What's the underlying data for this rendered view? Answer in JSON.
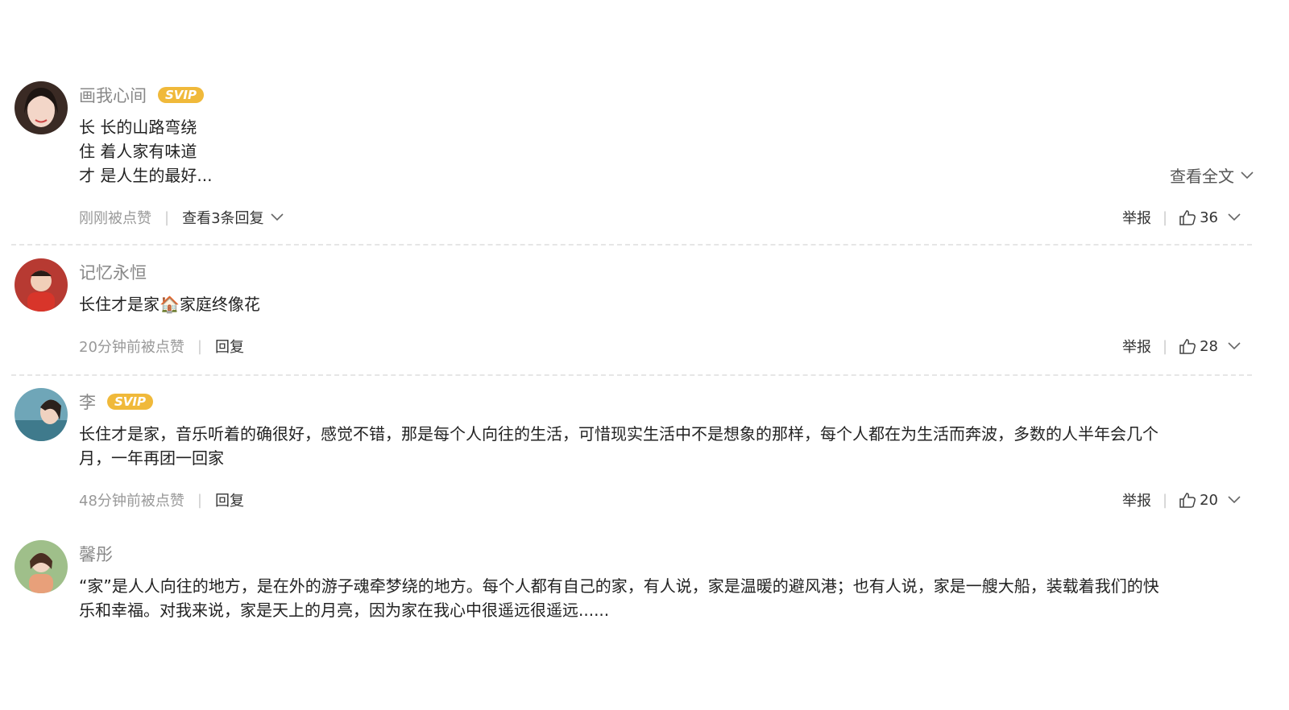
{
  "comments": [
    {
      "user": "画我心间",
      "badge": "SVIP",
      "text": "长 长的山路弯绕\n住 着人家有味道\n才 是人生的最好...",
      "expand_label": "查看全文",
      "time": "刚刚被点赞",
      "reply_label": "查看3条回复",
      "report_label": "举报",
      "likes": "36"
    },
    {
      "user": "记忆永恒",
      "badge": "",
      "text": "长住才是家🏠家庭终像花",
      "time": "20分钟前被点赞",
      "reply_label": "回复",
      "report_label": "举报",
      "likes": "28"
    },
    {
      "user": "李",
      "badge": "SVIP",
      "text": "长住才是家，音乐听着的确很好，感觉不错，那是每个人向往的生活，可惜现实生活中不是想象的那样，每个人都在为生活而奔波，多数的人半年会几个\n月，一年再团一回家",
      "time": "48分钟前被点赞",
      "reply_label": "回复",
      "report_label": "举报",
      "likes": "20"
    },
    {
      "user": "馨彤",
      "badge": "",
      "text": "“家”是人人向往的地方，是在外的游子魂牵梦绕的地方。每个人都有自己的家，有人说，家是温暖的避风港；也有人说，家是一艘大船，装载着我们的快\n乐和幸福。对我来说，家是天上的月亮，因为家在我心中很遥远很遥远......"
    }
  ],
  "colors": {
    "svip": "#f0b93a",
    "username": "#888888",
    "divider": "#e6e6e6"
  },
  "icons": [
    "chevron-down-icon",
    "thumbs-up-icon",
    "avatar"
  ]
}
